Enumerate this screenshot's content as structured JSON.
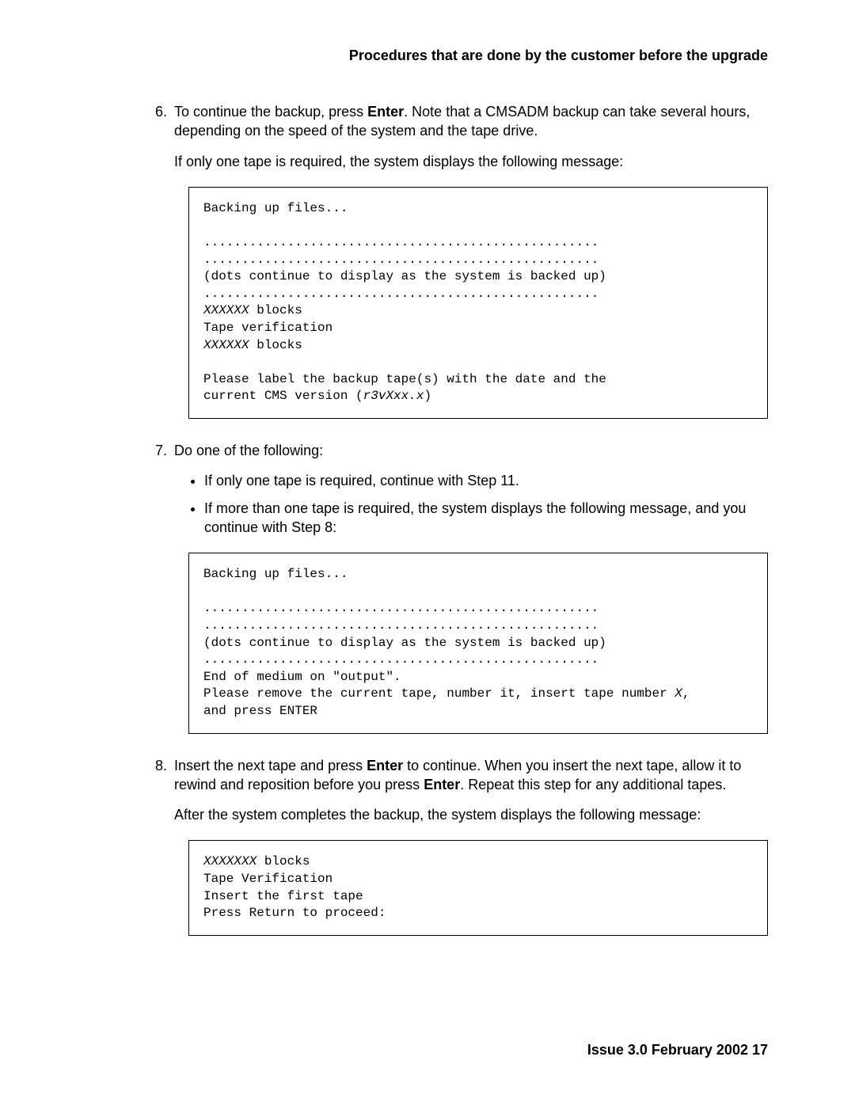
{
  "header": "Procedures that are done by the customer before the upgrade",
  "step6": {
    "num": "6.",
    "text_a": "To continue the backup, press ",
    "enter": "Enter",
    "text_b": ". Note that a CMSADM backup can take several hours, depending on the speed of the system and the tape drive.",
    "para2": "If only one tape is required, the system displays the following message:"
  },
  "code1": {
    "l1": "Backing up files...",
    "blank1": "",
    "l2": "....................................................",
    "l3": "....................................................",
    "l4": "(dots continue to display as the system is backed up)",
    "l5": "....................................................",
    "l6a": "XXXXXX",
    "l6b": " blocks",
    "l7": "Tape verification",
    "l8a": "XXXXXX",
    "l8b": " blocks",
    "blank2": "",
    "l9": "Please label the backup tape(s) with the date and the",
    "l10a": "current CMS version (",
    "l10b": "r3vXxx.x",
    "l10c": ")"
  },
  "step7": {
    "num": "7.",
    "text": "Do one of the following:",
    "bullet1": "If only one tape is required, continue with Step 11.",
    "bullet2": "If more than one tape is required, the system displays the following message, and you continue with Step 8:"
  },
  "code2": {
    "l1": "Backing up files...",
    "blank1": "",
    "l2": "....................................................",
    "l3": "....................................................",
    "l4": "(dots continue to display as the system is backed up)",
    "l5": "....................................................",
    "l6": "End of medium on \"output\".",
    "l7a": "Please remove the current tape, number it, insert tape number ",
    "l7b": "X",
    "l7c": ",",
    "l8": "and press ENTER"
  },
  "step8": {
    "num": "8.",
    "text_a": "Insert the next tape and press ",
    "enter1": "Enter",
    "text_b": " to continue. When you insert the next tape, allow it to rewind and reposition before you press ",
    "enter2": "Enter",
    "text_c": ". Repeat this step for any additional tapes.",
    "para2": "After the system completes the backup, the system displays the following message:"
  },
  "code3": {
    "l1a": "XXXXXXX",
    "l1b": " blocks",
    "l2": "Tape Verification",
    "l3": "Insert the first tape",
    "l4": "Press Return to proceed:"
  },
  "footer": "Issue 3.0   February 2002   17"
}
